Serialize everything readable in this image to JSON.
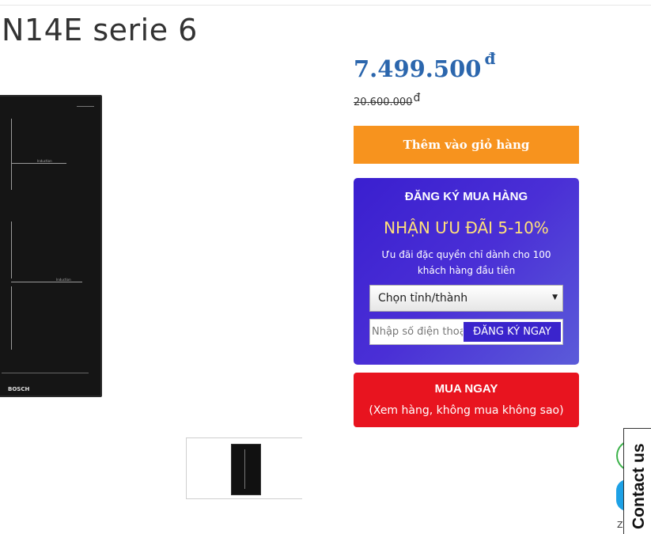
{
  "product": {
    "title": "N14E serie 6",
    "price": "7.499.500",
    "price_currency": "đ",
    "old_price": "20.600.000",
    "old_price_currency": "đ"
  },
  "image": {
    "label_top": "Induction",
    "label_bottom": "Induction",
    "brand": "BOSCH"
  },
  "buttons": {
    "add_to_cart": "Thêm vào giỏ hàng"
  },
  "register": {
    "title": "ĐĂNG KÝ MUA HÀNG",
    "offer": "NHẬN ƯU ĐÃI 5-10%",
    "description": "Ưu đãi đặc quyền chỉ dành cho 100 khách hàng đầu tiên",
    "province_select": "Chọn tỉnh/thành",
    "phone_placeholder": "Nhập số điện thoại",
    "submit": "ĐĂNG KÝ NGAY"
  },
  "buy_now": {
    "title": "MUA NGAY",
    "subtitle": "(Xem hàng, không mua không sao)"
  },
  "contact": {
    "label": "Contact us",
    "zalo_label": "Zalo"
  },
  "colors": {
    "price": "#2b66ad",
    "cart_button": "#f7931e",
    "register_box": "#4a2fd6",
    "offer_text": "#ffe07a",
    "buy_button": "#e8141f"
  }
}
